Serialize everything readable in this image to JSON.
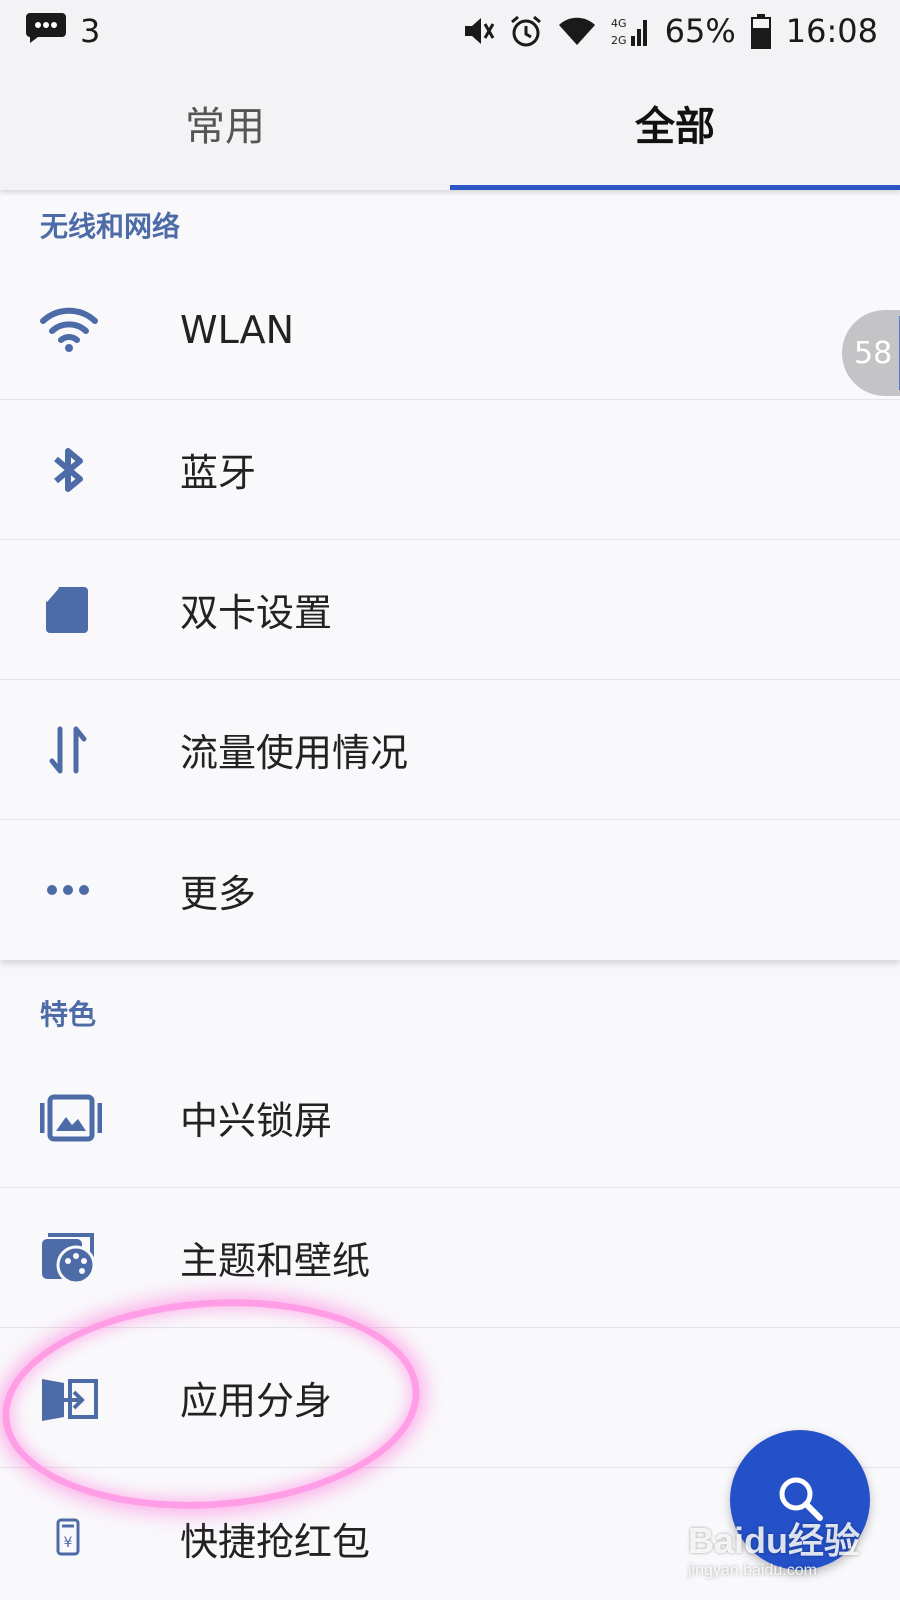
{
  "status_bar": {
    "notification_count": "3",
    "battery_percent": "65%",
    "time": "16:08",
    "network_labels": [
      "4G",
      "2G"
    ]
  },
  "tabs": [
    {
      "label": "常用",
      "active": false
    },
    {
      "label": "全部",
      "active": true
    }
  ],
  "sections": [
    {
      "title": "无线和网络",
      "items": [
        {
          "label": "WLAN",
          "icon": "wifi-icon"
        },
        {
          "label": "蓝牙",
          "icon": "bluetooth-icon"
        },
        {
          "label": "双卡设置",
          "icon": "sim-card-icon"
        },
        {
          "label": "流量使用情况",
          "icon": "data-usage-icon"
        },
        {
          "label": "更多",
          "icon": "more-icon"
        }
      ]
    },
    {
      "title": "特色",
      "items": [
        {
          "label": "中兴锁屏",
          "icon": "lockscreen-icon"
        },
        {
          "label": "主题和壁纸",
          "icon": "theme-palette-icon"
        },
        {
          "label": "应用分身",
          "icon": "app-clone-icon"
        },
        {
          "label": "快捷抢红包",
          "icon": "red-packet-icon"
        }
      ]
    }
  ],
  "side_badge": "58",
  "watermark": {
    "main": "Baidu经验",
    "sub": "jingyan.baidu.com"
  },
  "colors": {
    "accent": "#2a56c6",
    "icon": "#4d6ba6",
    "fab": "#2450c8",
    "highlight": "#ff9ee6"
  }
}
